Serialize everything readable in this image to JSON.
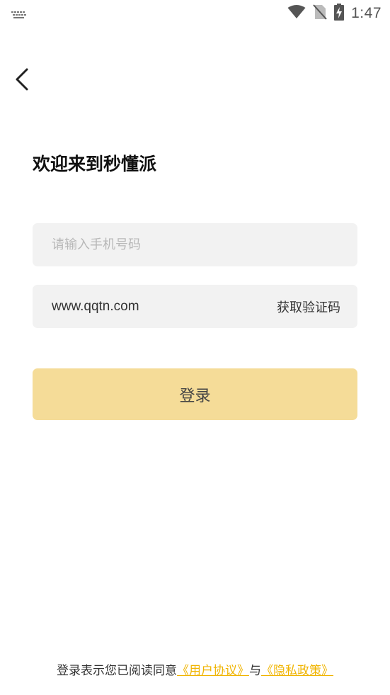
{
  "status_bar": {
    "time": "1:47",
    "icons": [
      "keyboard-icon",
      "wifi-icon",
      "no-sim-icon",
      "battery-charging-icon"
    ]
  },
  "header": {
    "back_icon": "chevron-left-icon"
  },
  "title": "欢迎来到秒懂派",
  "phone_input": {
    "placeholder": "请输入手机号码",
    "value": ""
  },
  "code_input": {
    "value": "www.qqtn.com",
    "get_code_label": "获取验证码"
  },
  "login_button": {
    "label": "登录"
  },
  "agreement": {
    "prefix": "登录表示您已阅读同意",
    "user_agreement": "《用户协议》",
    "conjunction": "与",
    "privacy_policy": "《隐私政策》"
  },
  "colors": {
    "accent": "#f5dc98",
    "link": "#f0b400",
    "field_bg": "#f2f2f2"
  }
}
